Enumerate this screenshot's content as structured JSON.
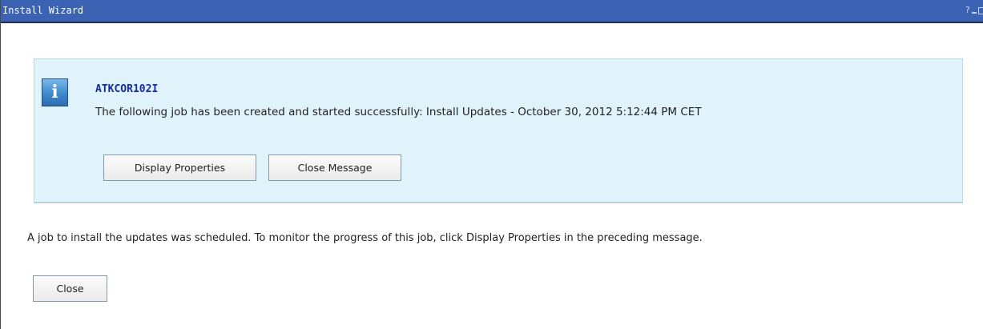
{
  "window": {
    "title": "Install Wizard",
    "controls": {
      "help": "?"
    }
  },
  "message": {
    "icon": "info-icon",
    "icon_glyph": "i",
    "code": "ATKCOR102I",
    "text": "The following job has been created and started successfully: Install Updates - October 30, 2012 5:12:44 PM CET",
    "buttons": {
      "display_properties": "Display Properties",
      "close_message": "Close Message"
    }
  },
  "body": {
    "text": "A job to install the updates was scheduled. To monitor the progress of this job, click Display Properties in the preceding message.",
    "close_button": "Close"
  },
  "colors": {
    "titlebar": "#3c62b4",
    "message_background": "#e1f3fa",
    "message_code": "#1629a8"
  }
}
